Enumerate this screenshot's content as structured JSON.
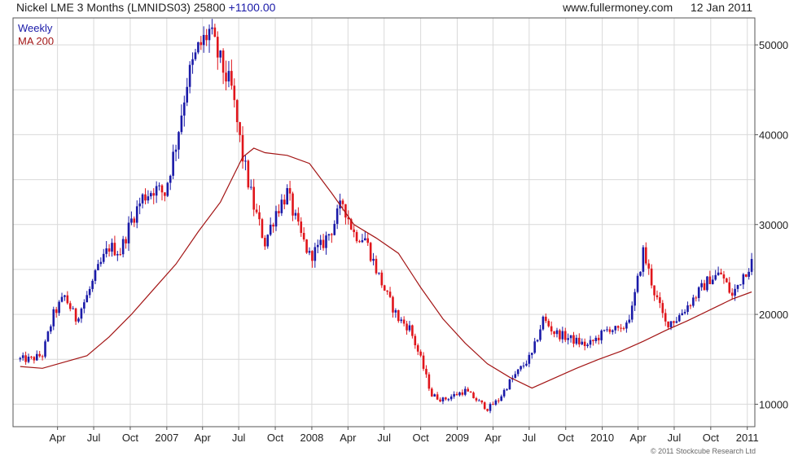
{
  "header": {
    "instrument": "Nickel LME 3 Months (LMNIDS03)",
    "last": "25800",
    "change": "+1100.00",
    "site": "www.fullermoney.com",
    "date": "12 Jan 2011"
  },
  "legend": {
    "weekly": "Weekly",
    "ma": "MA 200"
  },
  "footer": {
    "copyright": "© 2011 Stockcube Research Ltd"
  },
  "colors": {
    "up": "#1a1aa8",
    "down": "#e0151b",
    "ma": "#a31515",
    "grid": "#d9d9d9",
    "frame": "#555555"
  },
  "chart_data": {
    "type": "line",
    "series": [
      {
        "name": "Weekly",
        "x": [
          "2005-12-28",
          "2006-01-25",
          "2006-02-22",
          "2006-03-22",
          "2006-04-19",
          "2006-05-17",
          "2006-06-14",
          "2006-07-12",
          "2006-08-09",
          "2006-09-06",
          "2006-10-04",
          "2006-11-01",
          "2006-11-29",
          "2006-12-27",
          "2007-01-24",
          "2007-02-21",
          "2007-03-21",
          "2007-04-18",
          "2007-05-16",
          "2007-06-13",
          "2007-07-11",
          "2007-08-08",
          "2007-09-05",
          "2007-10-03",
          "2007-10-31",
          "2007-11-28",
          "2007-12-26",
          "2008-01-23",
          "2008-02-20",
          "2008-03-19",
          "2008-04-16",
          "2008-05-14",
          "2008-06-11",
          "2008-07-09",
          "2008-08-06",
          "2008-09-03",
          "2008-10-01",
          "2008-10-29",
          "2008-11-26",
          "2008-12-24",
          "2009-01-21",
          "2009-02-18",
          "2009-03-18",
          "2009-04-15",
          "2009-05-13",
          "2009-06-10",
          "2009-07-08",
          "2009-08-05",
          "2009-09-02",
          "2009-09-30",
          "2009-10-28",
          "2009-11-25",
          "2009-12-23",
          "2010-01-20",
          "2010-02-17",
          "2010-03-17",
          "2010-04-14",
          "2010-05-12",
          "2010-06-09",
          "2010-07-07",
          "2010-08-04",
          "2010-09-01",
          "2010-09-29",
          "2010-10-27",
          "2010-11-24",
          "2010-12-22",
          "2011-01-12"
        ],
        "values": [
          15000,
          15000,
          15500,
          20000,
          22000,
          19500,
          22000,
          25000,
          27500,
          27000,
          30500,
          33000,
          34000,
          33500,
          39000,
          46000,
          49500,
          51500,
          48000,
          45000,
          37500,
          32000,
          28000,
          31500,
          33500,
          29500,
          26500,
          27500,
          29500,
          32500,
          29000,
          28500,
          25000,
          22000,
          19500,
          18500,
          15000,
          11000,
          10500,
          11000,
          11500,
          10500,
          9500,
          10500,
          12500,
          14000,
          15500,
          19500,
          18000,
          17500,
          17000,
          16500,
          17500,
          18500,
          18000,
          20500,
          27000,
          22500,
          19000,
          19500,
          21000,
          22500,
          24000,
          24500,
          22000,
          24500,
          25800
        ]
      },
      {
        "name": "MA 200",
        "x": [
          "2005-12-28",
          "2006-02-22",
          "2006-04-19",
          "2006-06-14",
          "2006-08-09",
          "2006-10-04",
          "2006-11-29",
          "2007-01-24",
          "2007-03-21",
          "2007-05-16",
          "2007-07-11",
          "2007-08-08",
          "2007-09-05",
          "2007-10-31",
          "2007-12-26",
          "2008-02-20",
          "2008-04-16",
          "2008-06-11",
          "2008-08-06",
          "2008-10-01",
          "2008-11-26",
          "2009-01-21",
          "2009-03-18",
          "2009-05-13",
          "2009-07-08",
          "2009-09-02",
          "2009-10-28",
          "2009-12-23",
          "2010-02-17",
          "2010-04-14",
          "2010-06-09",
          "2010-08-04",
          "2010-09-29",
          "2010-11-24",
          "2011-01-12"
        ],
        "values": [
          14200,
          14000,
          14700,
          15400,
          17500,
          20000,
          22800,
          25600,
          29200,
          32500,
          37500,
          38500,
          38000,
          37700,
          36800,
          33500,
          30000,
          28500,
          26800,
          23000,
          19500,
          16800,
          14500,
          13000,
          11800,
          12900,
          14000,
          15000,
          15900,
          17000,
          18200,
          19300,
          20500,
          21700,
          22500
        ]
      }
    ],
    "x_ticks": [
      "Apr",
      "Jul",
      "Oct",
      "2007",
      "Apr",
      "Jul",
      "Oct",
      "2008",
      "Apr",
      "Jul",
      "Oct",
      "2009",
      "Apr",
      "Jul",
      "Oct",
      "2010",
      "Apr",
      "Jul",
      "Oct",
      "2011"
    ],
    "y_ticks": [
      10000,
      20000,
      30000,
      40000,
      50000
    ],
    "ylim": [
      7500,
      53000
    ]
  }
}
